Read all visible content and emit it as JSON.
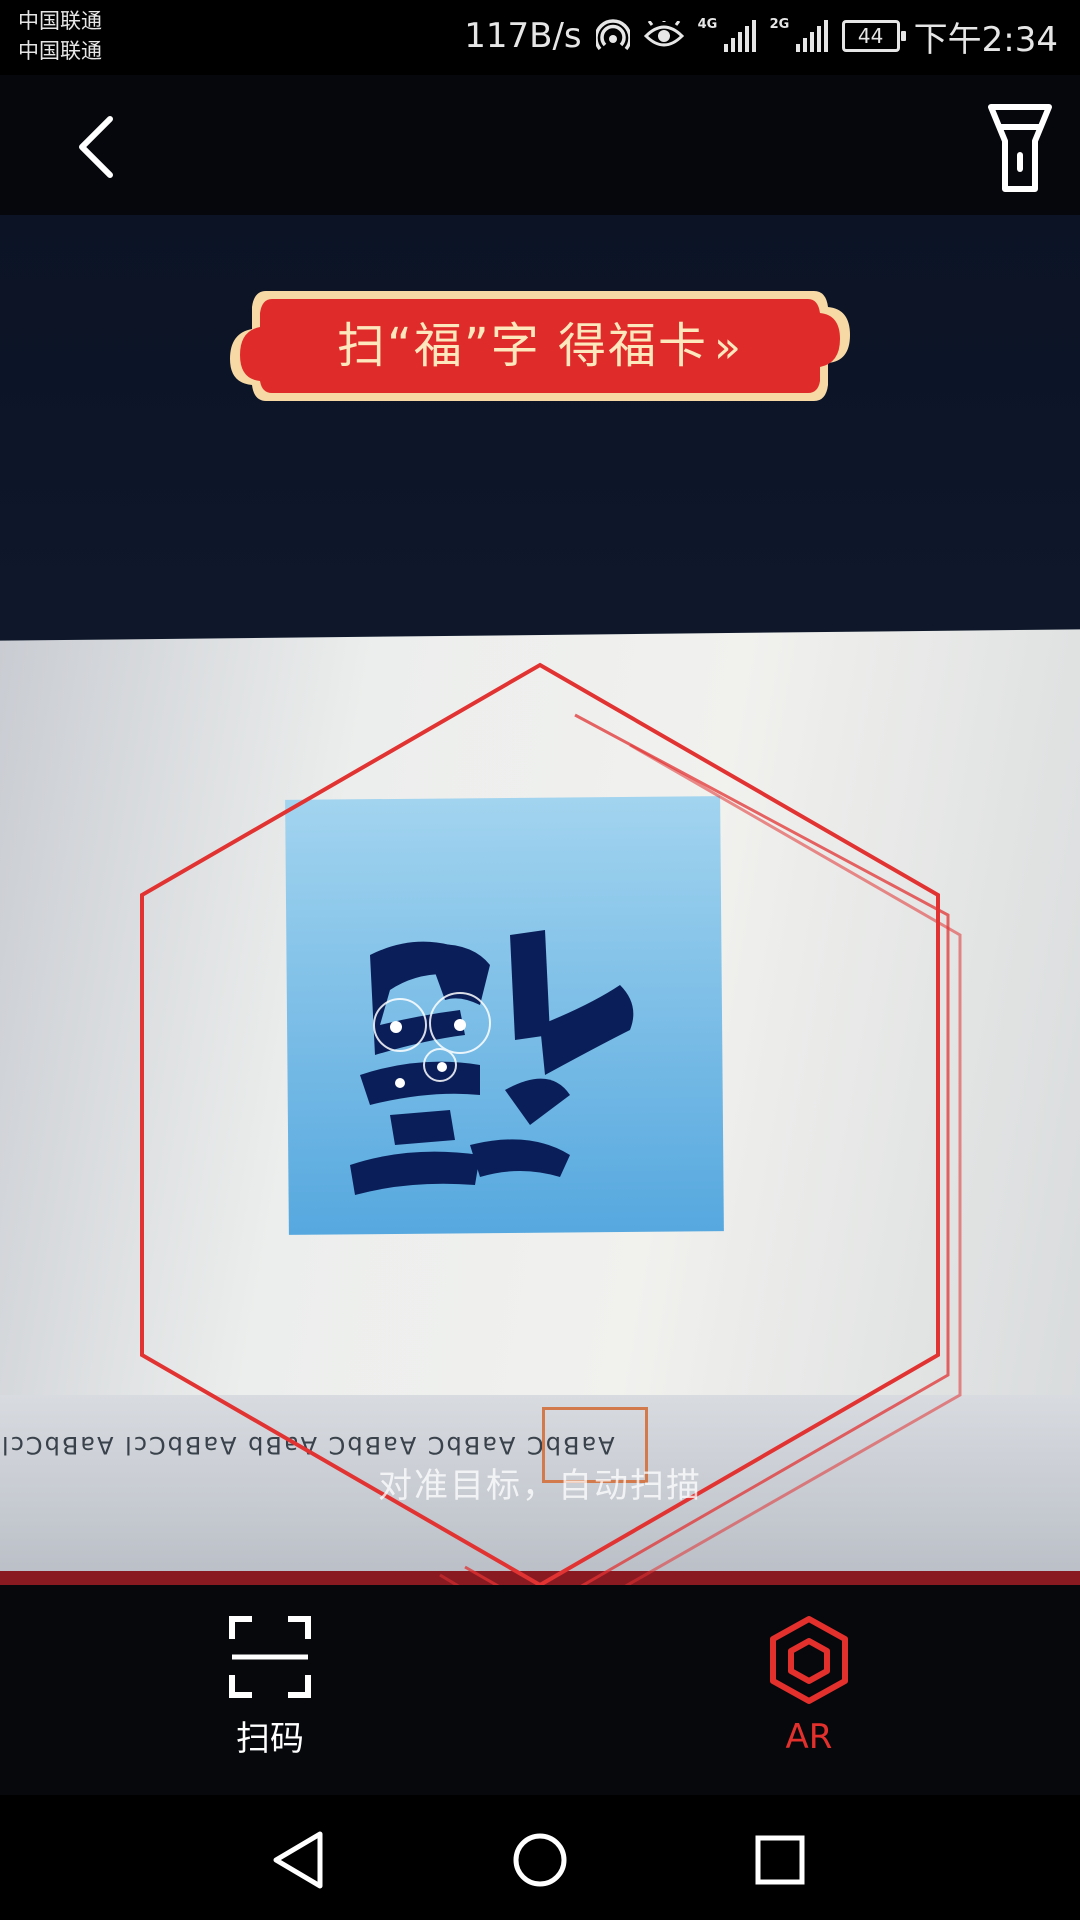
{
  "status_bar": {
    "carrier_1": "中国联通",
    "carrier_2": "中国联通",
    "net_speed": "117B/s",
    "signal_1_tag": "4G",
    "signal_2_tag": "2G",
    "battery": "44",
    "time": "下午2:34"
  },
  "header": {
    "back_icon": "chevron-left-icon",
    "flashlight_icon": "flashlight-icon"
  },
  "banner": {
    "text": "扫“福”字  得福卡",
    "arrows": "»",
    "bg_color": "#e02b2b",
    "text_color": "#fde7bd"
  },
  "scanner": {
    "frame_color": "#e23333",
    "hint": "对准目标，自动扫描"
  },
  "tabs": [
    {
      "label": "扫码",
      "icon": "scan-frame-icon",
      "active": false
    },
    {
      "label": "AR",
      "icon": "hexagon-icon",
      "active": true,
      "color": "#e3302d"
    }
  ],
  "ribbon": {
    "styles_text": "AaBbC AaBbC AaBbC AaBb AaBbCcl AaBbCcl"
  },
  "nav": {
    "back": "triangle-back-icon",
    "home": "circle-home-icon",
    "recents": "square-recents-icon"
  }
}
